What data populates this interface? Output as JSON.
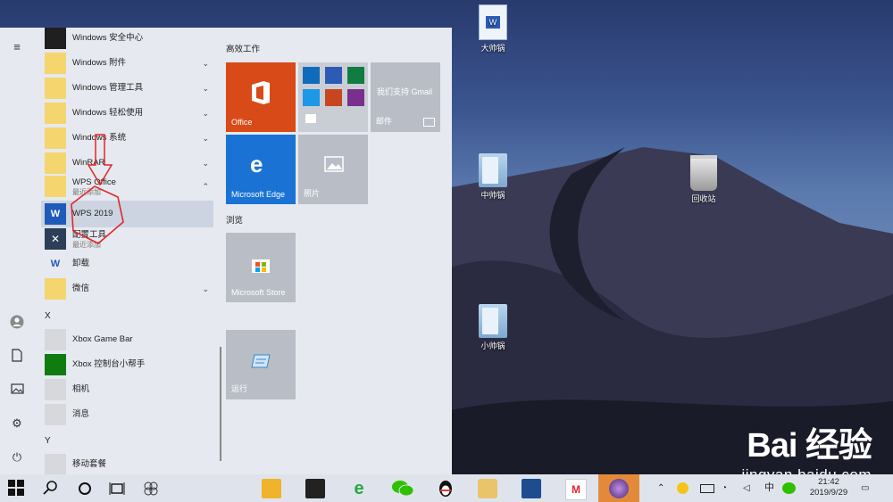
{
  "desktop": {
    "icons": [
      {
        "label": "大帅锅",
        "kind": "doc"
      },
      {
        "label": "中帅锅",
        "kind": "folder"
      },
      {
        "label": "回收站",
        "kind": "bin"
      },
      {
        "label": "小帅锅",
        "kind": "folder"
      }
    ],
    "watermark": {
      "brand": "Bai 经验",
      "url": "jingyan.baidu.com"
    }
  },
  "start_menu": {
    "apps": [
      {
        "label": "Windows 安全中心"
      },
      {
        "label": "Windows 附件"
      },
      {
        "label": "Windows 管理工具"
      },
      {
        "label": "Windows 轻松使用"
      },
      {
        "label": "Windows 系统"
      },
      {
        "label": "WinRAR"
      },
      {
        "label": "WPS Office",
        "sub": "最近添加"
      },
      {
        "label": "WPS 2019"
      },
      {
        "label": "配置工具",
        "sub": "最近添加"
      },
      {
        "label": "卸载"
      },
      {
        "label": "微信"
      }
    ],
    "letter_x": "X",
    "apps_x": [
      {
        "label": "Xbox Game Bar"
      },
      {
        "label": "Xbox 控制台小帮手"
      },
      {
        "label": "相机"
      },
      {
        "label": "消息"
      }
    ],
    "letter_y": "Y",
    "apps_y": [
      {
        "label": "移动套餐"
      }
    ],
    "groups": {
      "efficiency": "高效工作",
      "browse": "浏览"
    },
    "tiles": {
      "office": "Office",
      "gmail": "我们支持 Gmail",
      "mail": "邮件",
      "edge": "Microsoft Edge",
      "photos": "照片",
      "store": "Microsoft Store",
      "run": "运行"
    }
  },
  "taskbar": {
    "ime": "中",
    "time": "21:42",
    "date": "2019/9/29"
  },
  "colors": {
    "office_orange": "#d84a17",
    "edge_blue": "#1a73d4",
    "wps_blue": "#1e5ab8",
    "annotation_red": "#e0262b",
    "tile_gray": "#b9bec6"
  }
}
